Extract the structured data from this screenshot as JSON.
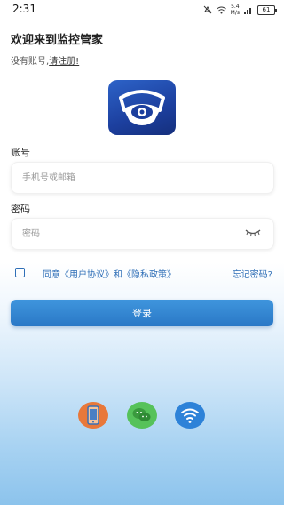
{
  "status_bar": {
    "time": "2:31",
    "speed_value": "5.4",
    "speed_unit": "M/s",
    "battery": "61"
  },
  "welcome_title": "欢迎来到监控管家",
  "register": {
    "prompt": "没有账号,",
    "link_label": "请注册!"
  },
  "account": {
    "label": "账号",
    "placeholder": "手机号或邮箱"
  },
  "password": {
    "label": "密码",
    "placeholder": "密码"
  },
  "agreement": {
    "text": "同意《用户协议》和《隐私政策》",
    "forgot_label": "忘记密码?"
  },
  "login_label": "登录",
  "social_icons": [
    "phone-icon",
    "wechat-icon",
    "wifi-icon"
  ],
  "colors": {
    "accent": "#2f6fb7",
    "login_button": "#3389d4",
    "phone_bg": "#e8783a",
    "wechat_bg": "#56c25a",
    "wifi_bg": "#2d82d8"
  }
}
